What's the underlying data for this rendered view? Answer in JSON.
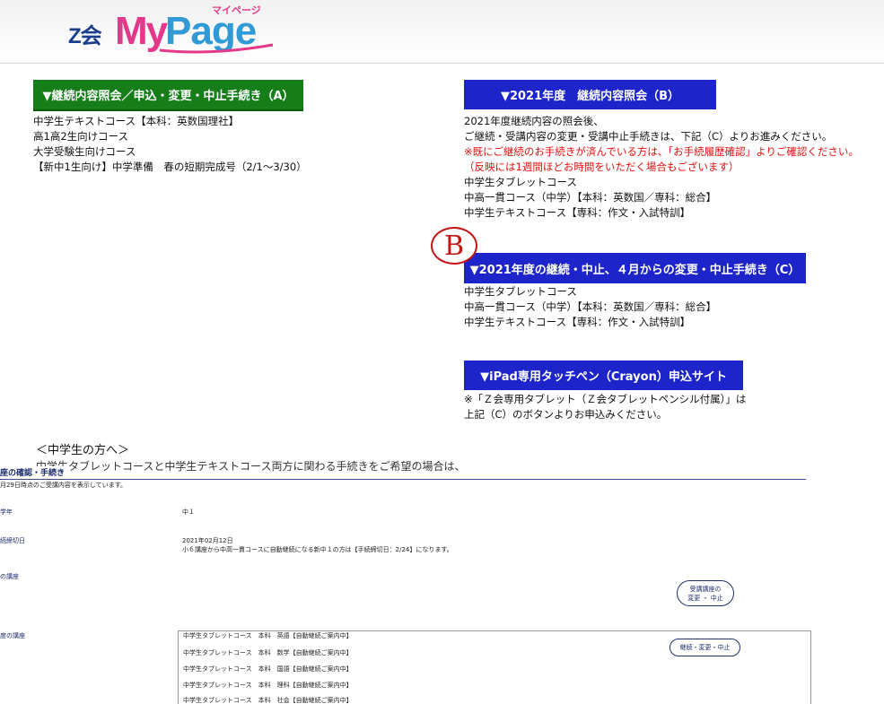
{
  "header": {
    "logo_z": "Z会",
    "logo_my": "My",
    "logo_page": "Page",
    "logo_sub": "マイページ"
  },
  "left": {
    "button_a": "▼継続内容照会／申込・変更・中止手続き（A）",
    "courses": [
      "中学生テキストコース【本科：英数国理社】",
      "高1高2生向けコース",
      "大学受験生向けコース",
      "【新中1生向け】中学準備　春の短期完成号（2/1～3/30）"
    ]
  },
  "right": {
    "button_b": "▼2021年度　継続内容照会（B）",
    "b_text": [
      "2021年度継続内容の照会後、",
      "ご継続・受講内容の変更・受講中止手続きは、下記（C）よりお進みください。"
    ],
    "b_notice": [
      "※既にご継続のお手続きが済んでいる方は、「お手続履歴確認」よりご確認ください。",
      "（反映には1週間ほどお時間をいただく場合もございます）"
    ],
    "b_courses": [
      "中学生タブレットコース",
      "中高一貫コース（中学）【本科：英数国／専科：総合】",
      "中学生テキストコース【専科：作文・入試特訓】"
    ],
    "badge": "B",
    "button_c": "▼2021年度の継続・中止、４月からの変更・中止手続き（C）",
    "c_courses": [
      "中学生タブレットコース",
      "中高一貫コース（中学）【本科：英数国／専科：総合】",
      "中学生テキストコース【専科：作文・入試特訓】"
    ],
    "button_ipad": "▼iPad専用タッチペン（Crayon）申込サイト",
    "ipad_text": [
      "※「Ｚ会専用タブレット（Ｚ会タブレットペンシル付属）」は",
      "上記（C）のボタンよりお申込みください。"
    ]
  },
  "students": {
    "heading": "＜中学生の方へ＞",
    "text": "中学生タブレットコースと中学生テキストコース両方に関わる手続きをご希望の場合は、"
  },
  "inner": {
    "title": "座の確認・手続き",
    "note": "月29日時点のご受講内容を表示しています。",
    "grade_label": "学年",
    "grade_value": "中１",
    "deadline_label": "続締切日",
    "deadline_date": "2021年02月12日",
    "deadline_note": "小６講座から中高一貫コースに自動継続になる新中１の方は【手続締切日：2/24】になります。",
    "current_label": "の講座",
    "change_button": "受講講座の\n変更 ・ 中止",
    "next_label": "度の講座",
    "continue_button": "継続・変更・中止",
    "rows": [
      "中学生タブレットコース　本科　英語【自動継続ご案内中】",
      "中学生タブレットコース　本科　数学【自動継続ご案内中】",
      "中学生タブレットコース　本科　国語【自動継続ご案内中】",
      "中学生タブレットコース　本科　理科【自動継続ご案内中】",
      "中学生タブレットコース　本科　社会【自動継続ご案内中】"
    ]
  },
  "colors": {
    "green_button": "#157e19",
    "blue_button": "#1d24c9",
    "notice_red": "#e0110e",
    "badge_red": "#c21616",
    "logo_pink": "#e4388a",
    "logo_blue": "#2f9ad6"
  }
}
